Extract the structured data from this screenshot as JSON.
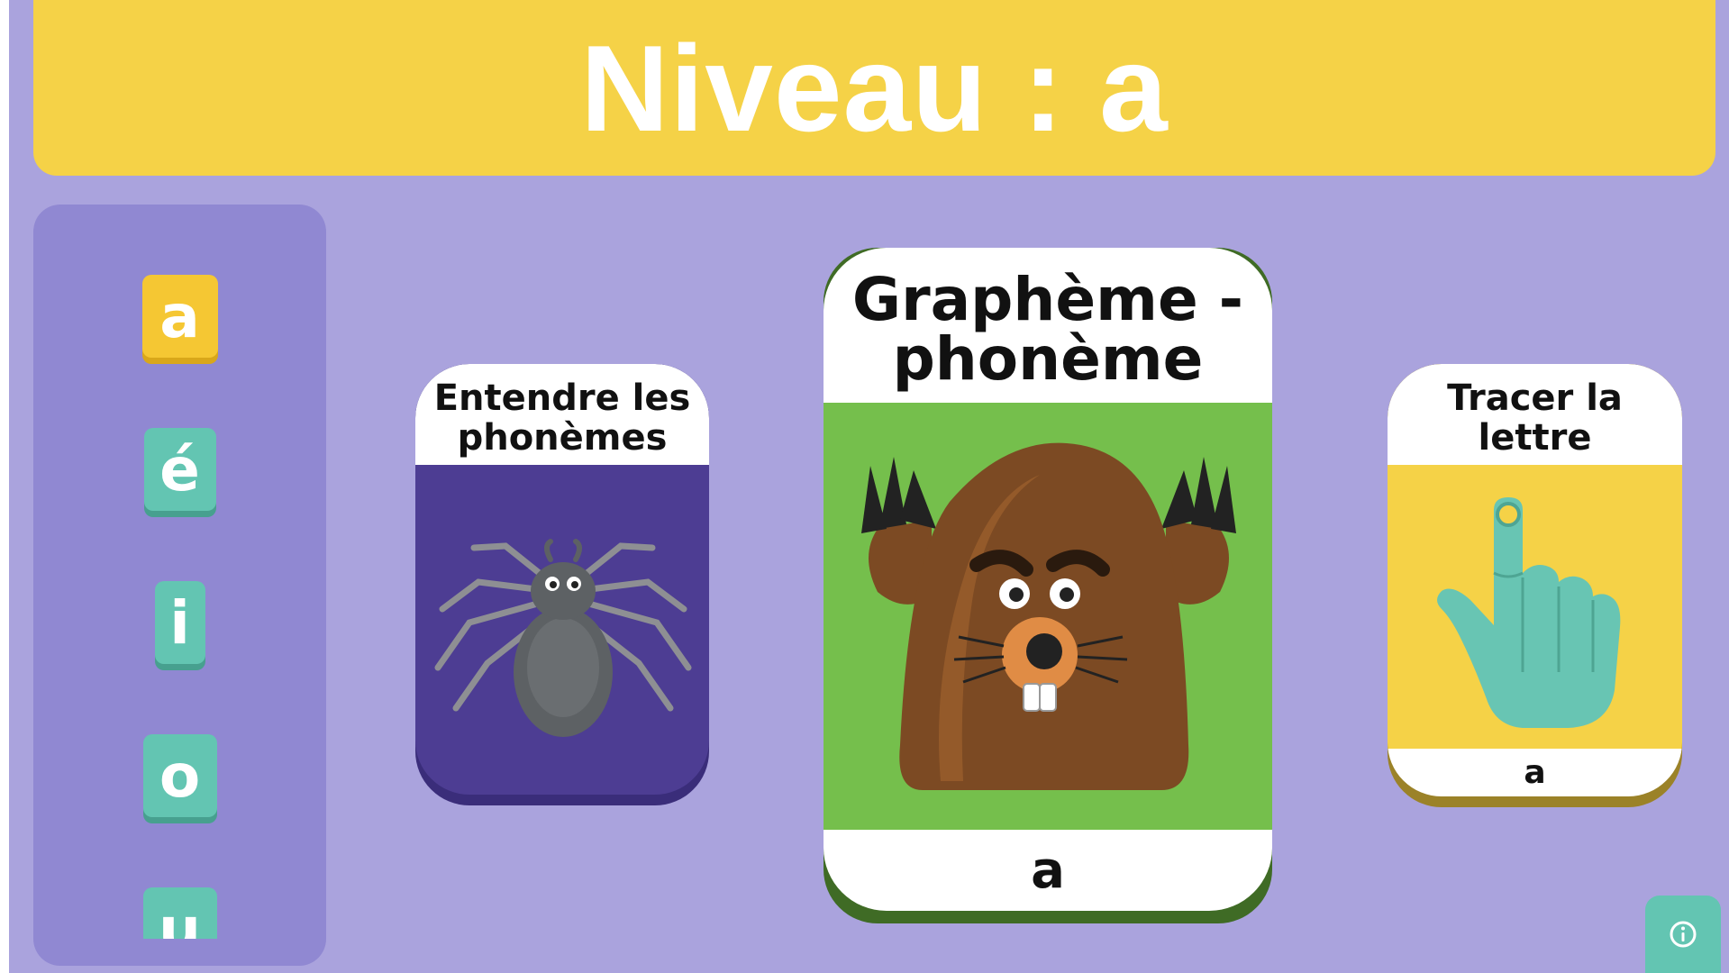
{
  "header": {
    "title": "Niveau : a"
  },
  "levels": [
    {
      "label": "a",
      "active": true
    },
    {
      "label": "é",
      "active": false
    },
    {
      "label": "i",
      "active": false
    },
    {
      "label": "o",
      "active": false
    },
    {
      "label": "u",
      "active": false
    }
  ],
  "cards": [
    {
      "title_line1": "Entendre les",
      "title_line2": "phonèmes",
      "image": "spider-icon"
    },
    {
      "title_line1": "Graphème -",
      "title_line2": "phonème",
      "image": "mole-character-icon",
      "letter": "a"
    },
    {
      "title_line1": "Tracer la",
      "title_line2": "lettre",
      "image": "pointing-hand-icon",
      "letter": "a"
    }
  ],
  "colors": {
    "background": "#aaa3dd",
    "header": "#f5d247",
    "panel": "#9088d2",
    "tile": "#63c5b2",
    "tile_active": "#f5c733",
    "card1_art": "#4d3d93",
    "card2_art": "#75bf4c",
    "card3_art": "#f5d247"
  },
  "info_button": {
    "icon": "info-icon"
  }
}
